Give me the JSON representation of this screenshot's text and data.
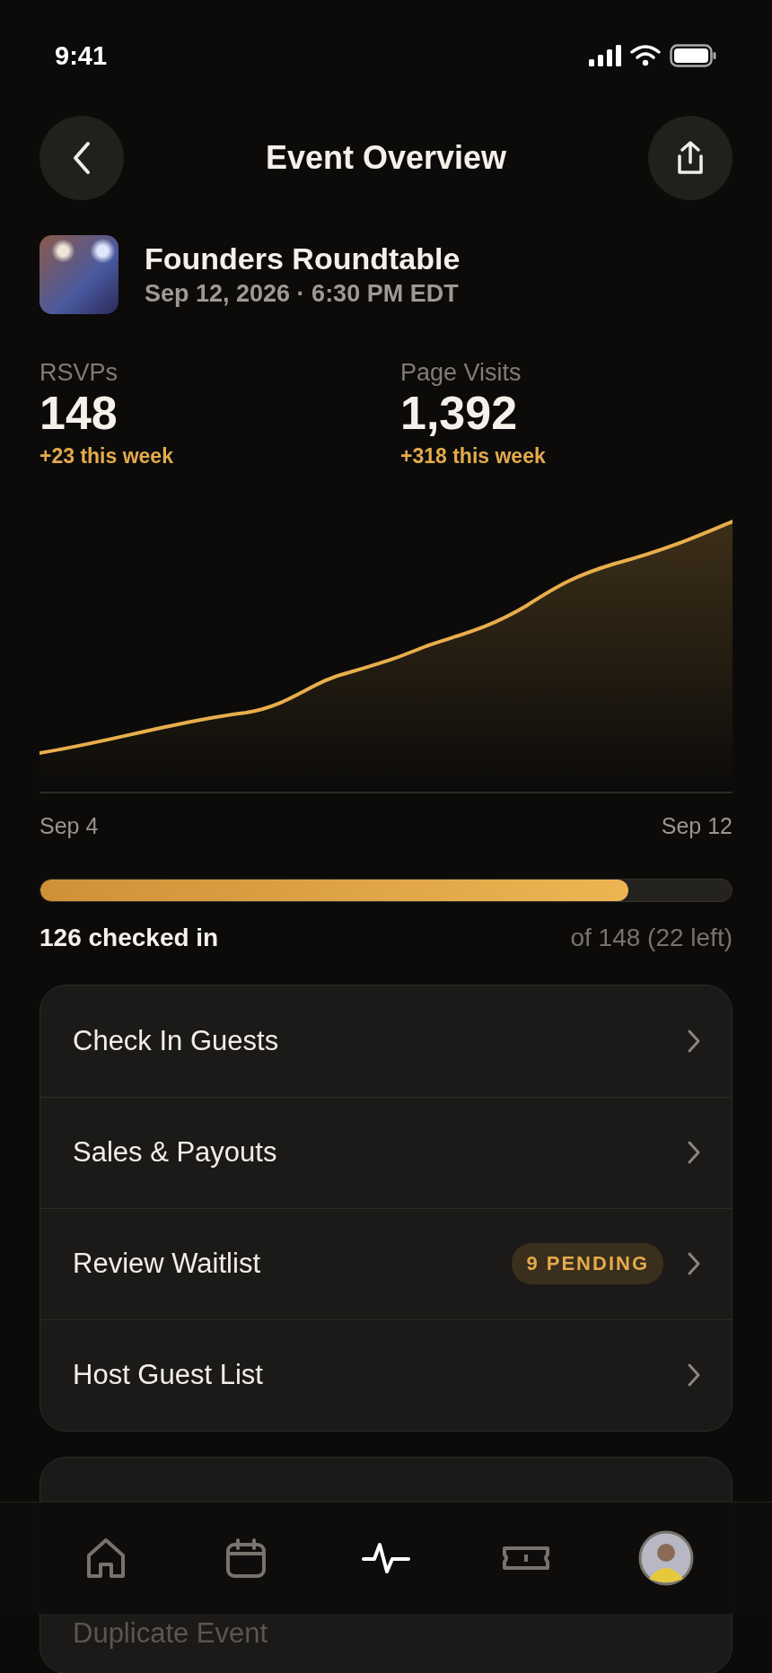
{
  "status_bar": {
    "time": "9:41"
  },
  "header": {
    "title": "Event Overview"
  },
  "event": {
    "name": "Founders Roundtable",
    "date": "Sep 12, 2026 · 6:30 PM EDT"
  },
  "stats": [
    {
      "label": "RSVPs",
      "value": "148",
      "delta": "+23 this week"
    },
    {
      "label": "Page Visits",
      "value": "1,392",
      "delta": "+318 this week"
    }
  ],
  "chart": {
    "start_label": "Sep 4",
    "end_label": "Sep 12"
  },
  "check_in": {
    "level": 0.851,
    "label": "126 checked in",
    "total": "of 148 (22 left)"
  },
  "actions": [
    {
      "label": "Check In Guests"
    },
    {
      "label": "Sales & Payouts"
    },
    {
      "label": "Review Waitlist",
      "badge": "9 PENDING"
    },
    {
      "label": "Host Guest List"
    }
  ],
  "more_actions": [
    {
      "label": "Duplicate Event"
    }
  ],
  "tab_bar": [
    {
      "selected": false
    },
    {
      "selected": false
    },
    {
      "selected": true
    },
    {
      "selected": false
    },
    {
      "selected": false
    }
  ]
}
